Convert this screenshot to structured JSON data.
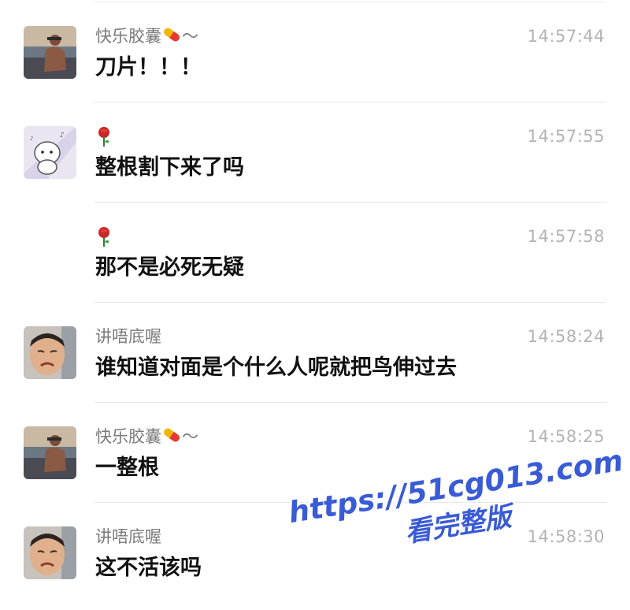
{
  "messages": [
    {
      "name": "快乐胶囊",
      "name_emoji": "pill-emoji",
      "name_suffix": "～",
      "time": "14:57:44",
      "text": "刀片！！！",
      "avatar": "sunset-man-avatar"
    },
    {
      "name": "",
      "name_emoji": "rose-emoji",
      "name_suffix": "",
      "time": "14:57:55",
      "text": "整根割下来了吗",
      "avatar": "cartoon-dog-avatar"
    },
    {
      "name": "",
      "name_emoji": "rose-emoji",
      "name_suffix": "",
      "time": "14:57:58",
      "text": "那不是必死无疑",
      "avatar": ""
    },
    {
      "name": "讲唔底喔",
      "name_emoji": "",
      "name_suffix": "",
      "time": "14:58:24",
      "text": "谁知道对面是个什么人呢就把鸟伸过去",
      "avatar": "crying-boy-avatar"
    },
    {
      "name": "快乐胶囊",
      "name_emoji": "pill-emoji",
      "name_suffix": "～",
      "time": "14:58:25",
      "text": "一整根",
      "avatar": "sunset-man-avatar"
    },
    {
      "name": "讲唔底喔",
      "name_emoji": "",
      "name_suffix": "",
      "time": "14:58:30",
      "text": "这不活该吗",
      "avatar": "crying-boy-avatar"
    }
  ],
  "watermark": {
    "url": "https://51cg013.com",
    "subtitle": "看完整版",
    "color": "#3a5bd6"
  }
}
